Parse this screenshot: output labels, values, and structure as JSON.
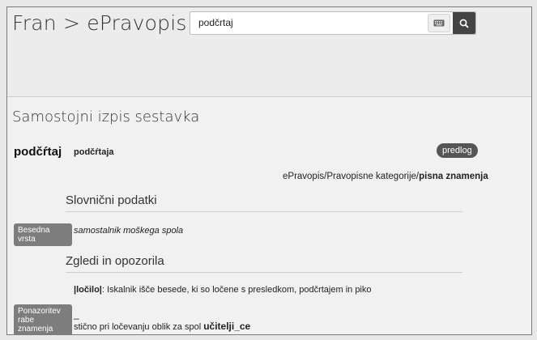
{
  "header": {
    "brand": "Fran > ePravopis",
    "search_value": "podčrtaj"
  },
  "entry": {
    "section_title": "Samostojni izpis sestavka",
    "headword": "podčŕtaj",
    "headword_form": "podčŕtaja",
    "badge": "predlog",
    "breadcrumb_prefix": "ePravopis/Pravopisne kategorije/",
    "breadcrumb_bold": "pisna znamenja"
  },
  "grammar": {
    "heading": "Slovnični podatki",
    "label": "Besedna vrsta",
    "value": "samostalnik moškega spola"
  },
  "examples": {
    "heading": "Zgledi in opozorila",
    "note_bold": "|ločilo|",
    "note_rest": ": Iskalnik išče besede, ki so ločene s presledkom, podčrtajem in piko",
    "label": "Ponazoritev rabe znamenja",
    "symbol": "_",
    "usage_prefix": "stično pri ločevanju oblik za spol ",
    "usage_example": "učitelji_ce"
  }
}
